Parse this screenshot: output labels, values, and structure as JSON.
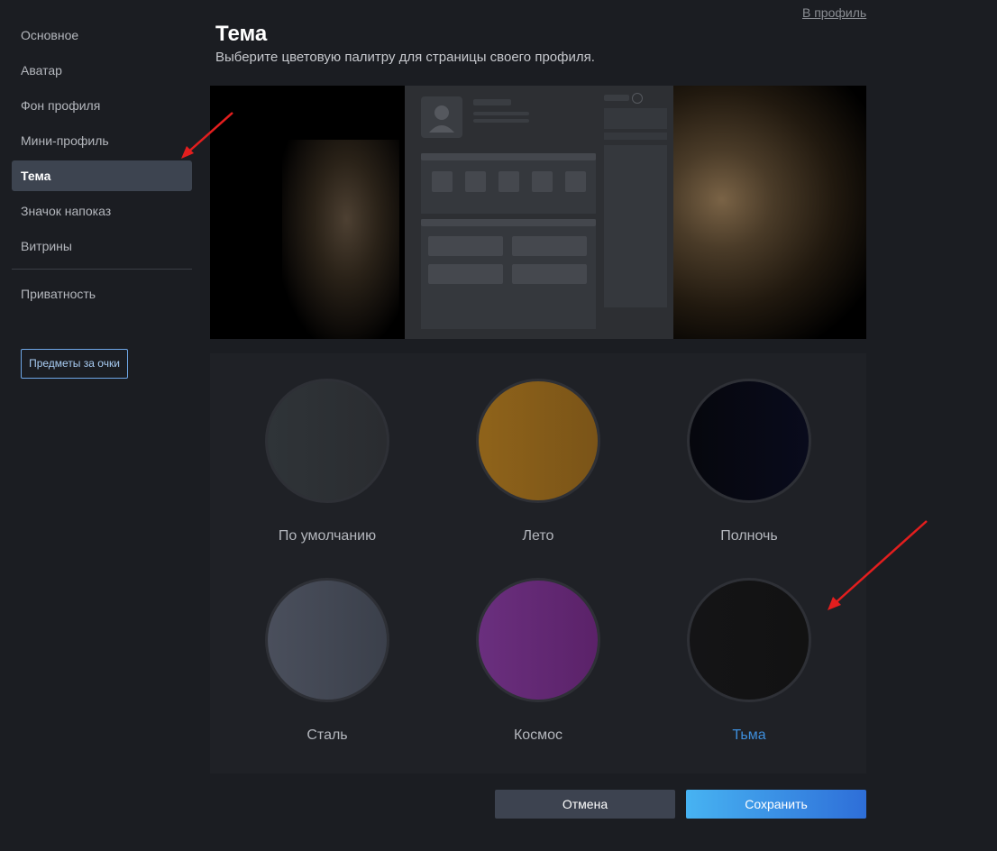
{
  "header": {
    "profile_link": "В профиль",
    "title": "Тема",
    "subtitle": "Выберите цветовую палитру для страницы своего профиля."
  },
  "sidebar": {
    "items": [
      {
        "label": "Основное"
      },
      {
        "label": "Аватар"
      },
      {
        "label": "Фон профиля"
      },
      {
        "label": "Мини-профиль"
      },
      {
        "label": "Тема",
        "active": true
      },
      {
        "label": "Значок напоказ"
      },
      {
        "label": "Витрины"
      }
    ],
    "privacy_label": "Приватность",
    "points_button": "Предметы за очки"
  },
  "themes": [
    {
      "label": "По умолчанию",
      "color_a": "#2f3438",
      "color_b": "#2a2c30"
    },
    {
      "label": "Лето",
      "color_a": "#8f631a",
      "color_b": "#7a5418"
    },
    {
      "label": "Полночь",
      "color_a": "#06070d",
      "color_b": "#090b1c"
    },
    {
      "label": "Сталь",
      "color_a": "#4a4f5c",
      "color_b": "#3b404b"
    },
    {
      "label": "Космос",
      "color_a": "#6a2f7e",
      "color_b": "#5b2269"
    },
    {
      "label": "Тьма",
      "color_a": "#141416",
      "color_b": "#121212",
      "selected": true
    }
  ],
  "buttons": {
    "cancel": "Отмена",
    "save": "Сохранить"
  },
  "colors": {
    "background": "#1b1d22",
    "accent_blue": "#3e8edb",
    "annotation_arrow": "#e31e1e"
  }
}
